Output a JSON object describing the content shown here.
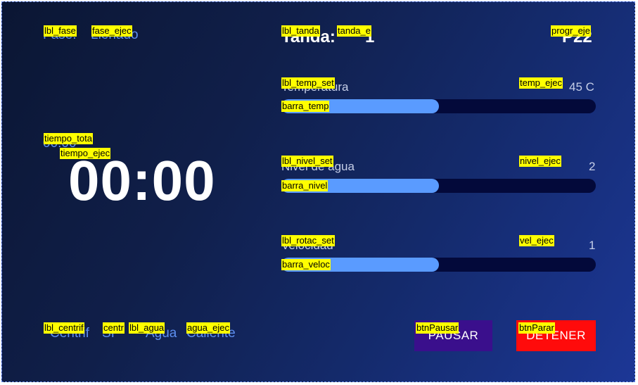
{
  "header": {
    "phase_label": "Fase:",
    "phase_value": "Llenado",
    "tanda_label": "Tanda:",
    "tanda_value": "1",
    "program_value": "P22"
  },
  "temperature": {
    "label": "Temperatura",
    "value": "45 C",
    "fill_fraction": 0.5
  },
  "water_level": {
    "label": "Nivel de agua",
    "value": "2",
    "fill_fraction": 0.5
  },
  "speed": {
    "label": "Velocidad",
    "value": "1",
    "fill_fraction": 0.5
  },
  "timer": {
    "total": "00:00",
    "elapsed": "00:00"
  },
  "footer": {
    "centrif_label": "Centrif",
    "centrif_value": "SI",
    "water_label": "Agua",
    "water_value": "Caliente"
  },
  "buttons": {
    "pause": "PAUSAR",
    "stop": "DETENER"
  },
  "debug_tags": {
    "lbl_fase": "lbl_fase",
    "fase_ejec": "fase_ejec",
    "lbl_tanda": "lbl_tanda",
    "tanda_e": "tanda_e",
    "progr_eje": "progr_eje",
    "lbl_temp_set": "lbl_temp_set",
    "temp_ejec": "temp_ejec",
    "barra_temp": "barra_temp",
    "tiempo_tota": "tiempo_tota",
    "tiempo_ejec": "tiempo_ejec",
    "lbl_nivel_set": "lbl_nivel_set",
    "nivel_ejec": "nivel_ejec",
    "barra_nivel": "barra_nivel",
    "lbl_rotac_set": "lbl_rotac_set",
    "vel_ejec": "vel_ejec",
    "barra_veloc": "barra_veloc",
    "lbl_centrif": "lbl_centrif",
    "centr": "centr",
    "lbl_agua": "lbl_agua",
    "agua_ejec": "agua_ejec",
    "btnPausar": "btnPausar",
    "btnParar": "btnParar"
  }
}
